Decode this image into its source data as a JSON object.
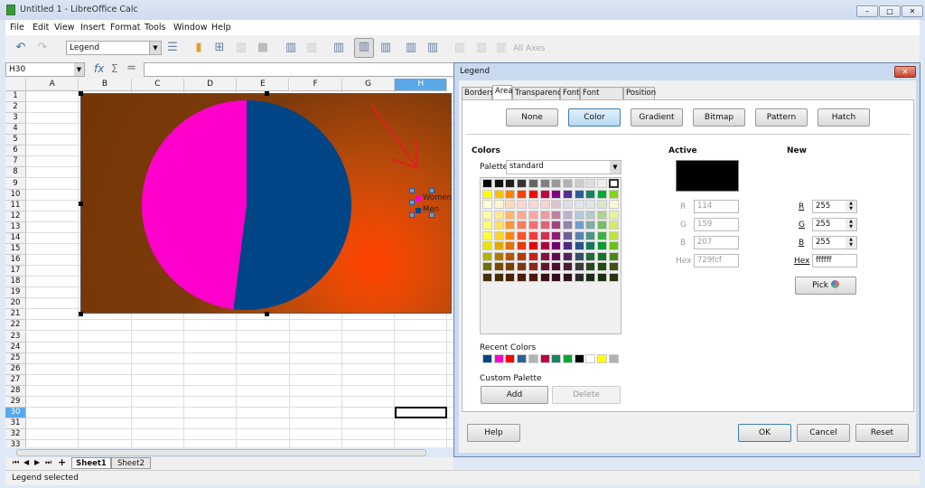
{
  "window": {
    "title": "Untitled 1 - LibreOffice Calc",
    "app_icon": "calc-icon"
  },
  "menu": [
    "File",
    "Edit",
    "View",
    "Insert",
    "Format",
    "Tools",
    "Window",
    "Help"
  ],
  "toolbar": {
    "element_select": "Legend",
    "all_axes": "All Axes"
  },
  "formula": {
    "cell_ref": "H30",
    "fx": "fx",
    "sum": "Σ",
    "eq": "=",
    "value": ""
  },
  "columns": [
    "A",
    "B",
    "C",
    "D",
    "E",
    "F",
    "G",
    "H"
  ],
  "rows": [
    "1",
    "2",
    "3",
    "4",
    "5",
    "6",
    "7",
    "8",
    "9",
    "10",
    "11",
    "12",
    "13",
    "14",
    "15",
    "16",
    "17",
    "18",
    "19",
    "20",
    "21",
    "22",
    "23",
    "24",
    "25",
    "26",
    "27",
    "28",
    "29",
    "30",
    "31",
    "32",
    "33"
  ],
  "selected_cell": "H30",
  "chart_data": {
    "type": "pie",
    "categories": [
      "Women",
      "Men"
    ],
    "values": [
      48,
      52
    ],
    "colors": [
      "#ff00cc",
      "#004586"
    ],
    "legend": "right",
    "background": "#7a3a0a gradient to #ff4000"
  },
  "sheets": [
    "Sheet1",
    "Sheet2"
  ],
  "active_sheet": "Sheet1",
  "status": "Legend selected",
  "dialog": {
    "title": "Legend",
    "tabs": [
      "Borders",
      "Area",
      "Transparency",
      "Font",
      "Font Effects",
      "Position"
    ],
    "active_tab": "Area",
    "fill_buttons": [
      "None",
      "Color",
      "Gradient",
      "Bitmap",
      "Pattern",
      "Hatch"
    ],
    "active_fill": "Color",
    "colors_label": "Colors",
    "palette_label": "Palette:",
    "palette_value": "standard",
    "palette": [
      [
        "#000000",
        "#111111",
        "#1c1c1c",
        "#333333",
        "#666666",
        "#808080",
        "#999999",
        "#b2b2b2",
        "#cccccc",
        "#dddddd",
        "#eeeeee",
        "#ffffff"
      ],
      [
        "#ffff00",
        "#ffbf00",
        "#ff8000",
        "#ff4000",
        "#ff0000",
        "#bf0041",
        "#800080",
        "#55308d",
        "#2a6099",
        "#158466",
        "#00a933",
        "#81d41a"
      ],
      [
        "#ffffd7",
        "#fff5ce",
        "#ffdbb6",
        "#ffd8ce",
        "#ffd7d7",
        "#f7d1d5",
        "#e0c2cd",
        "#dedce6",
        "#dee6ef",
        "#dee7e5",
        "#dde8cb",
        "#f6f9d4"
      ],
      [
        "#ffffa6",
        "#ffe994",
        "#ffb66c",
        "#ffaa95",
        "#ffa6a6",
        "#ec9ba4",
        "#bf819e",
        "#b7b3ca",
        "#b4c7dc",
        "#b3cac7",
        "#afd095",
        "#e8f2a1"
      ],
      [
        "#ffff6d",
        "#ffde59",
        "#ff972f",
        "#ff7b59",
        "#ff6d6d",
        "#e16173",
        "#a1467e",
        "#8e86ae",
        "#729fcf",
        "#81aca6",
        "#77bc65",
        "#d4ea6b"
      ],
      [
        "#ffff38",
        "#ffd428",
        "#ff860d",
        "#ff5429",
        "#ff3838",
        "#d62e4e",
        "#8d1d75",
        "#6b5e9b",
        "#5983b0",
        "#50938a",
        "#3faf46",
        "#bbe33d"
      ],
      [
        "#e6e600",
        "#e6a800",
        "#e67300",
        "#e63900",
        "#e60000",
        "#ac003a",
        "#730073",
        "#4c2b7f",
        "#265588",
        "#137759",
        "#009a2e",
        "#6cbf1a"
      ],
      [
        "#b2b200",
        "#b27800",
        "#b25900",
        "#b23b00",
        "#c9211e",
        "#861141",
        "#650953",
        "#55215b",
        "#355269",
        "#1e6a39",
        "#127622",
        "#468a1a"
      ],
      [
        "#706e0c",
        "#784b04",
        "#7b3d00",
        "#813709",
        "#8d281e",
        "#611729",
        "#4e102d",
        "#481d32",
        "#383d3c",
        "#28471f",
        "#224b12",
        "#395511"
      ],
      [
        "#443205",
        "#472e02",
        "#4a2300",
        "#4d1e05",
        "#52180f",
        "#3b0f17",
        "#330a1c",
        "#2f1220",
        "#2b2a2a",
        "#1d2d15",
        "#18330b",
        "#29360a"
      ]
    ],
    "recent_label": "Recent Colors",
    "recent": [
      "#004586",
      "#ff00cc",
      "#ff0000",
      "#2a6099",
      "#b2b2b2",
      "#bf0041",
      "#158466",
      "#00a933",
      "#000000",
      "#ffffff",
      "#ffff00",
      "#b2b2b2"
    ],
    "custom_label": "Custom Palette",
    "add": "Add",
    "delete": "Delete",
    "active_label": "Active",
    "active_color": "#000000",
    "active_r": "114",
    "active_g": "159",
    "active_b": "207",
    "active_hex": "729fcf",
    "new_label": "New",
    "new_color": "#ffffff",
    "new_r": "255",
    "new_g": "255",
    "new_b": "255",
    "new_hex": "ffffff",
    "r": "R",
    "g": "G",
    "b": "B",
    "hex": "Hex",
    "pick": "Pick",
    "help": "Help",
    "ok": "OK",
    "cancel": "Cancel",
    "reset": "Reset"
  }
}
